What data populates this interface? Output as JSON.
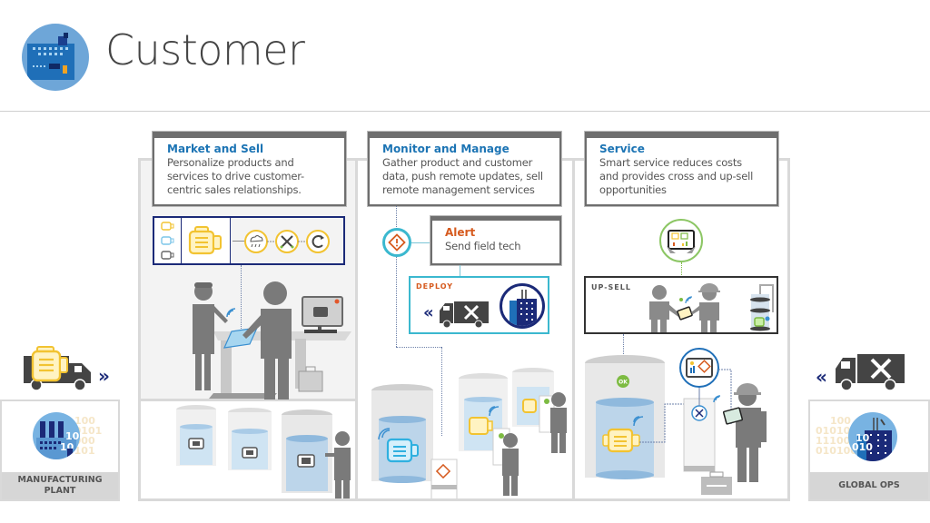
{
  "header": {
    "title": "Customer",
    "logo_icon": "factory-building-icon"
  },
  "colors": {
    "title_blue": "#1c74b4",
    "alert_orange": "#d65a1e",
    "card_border": "#6e6e6e",
    "frame_gray": "#f3f3f3",
    "navy": "#1b2a78",
    "teal": "#3bb8cf",
    "yellow": "#f2c331",
    "green": "#7dbb42",
    "figure_gray": "#7a7a7a"
  },
  "sections": [
    {
      "id": "market",
      "title": "Market and Sell",
      "lines": [
        "Personalize products and",
        "services to drive customer-",
        "centric sales relationships."
      ]
    },
    {
      "id": "monitor",
      "title": "Monitor and Manage",
      "lines": [
        "Gather product and customer",
        "data, push remote updates, sell",
        "remote management services"
      ]
    },
    {
      "id": "service",
      "title": "Service",
      "lines": [
        "Smart service reduces costs",
        "and provides cross and up-sell",
        "opportunities"
      ]
    }
  ],
  "alert": {
    "title": "Alert",
    "text": "Send field tech"
  },
  "deploy": {
    "label": "DEPLOY",
    "arrow": "«"
  },
  "upsell": {
    "label": "UP-SELL"
  },
  "ok_badge": "OK",
  "left_side": {
    "label_line1": "MANUFACTURING",
    "label_line2": "PLANT",
    "arrow": "»",
    "binary": [
      "100",
      "10101",
      "1000",
      "0101"
    ]
  },
  "right_side": {
    "label": "GLOBAL OPS",
    "arrow": "«",
    "binary": [
      "100",
      "010100",
      "1110010",
      "0101000"
    ]
  }
}
